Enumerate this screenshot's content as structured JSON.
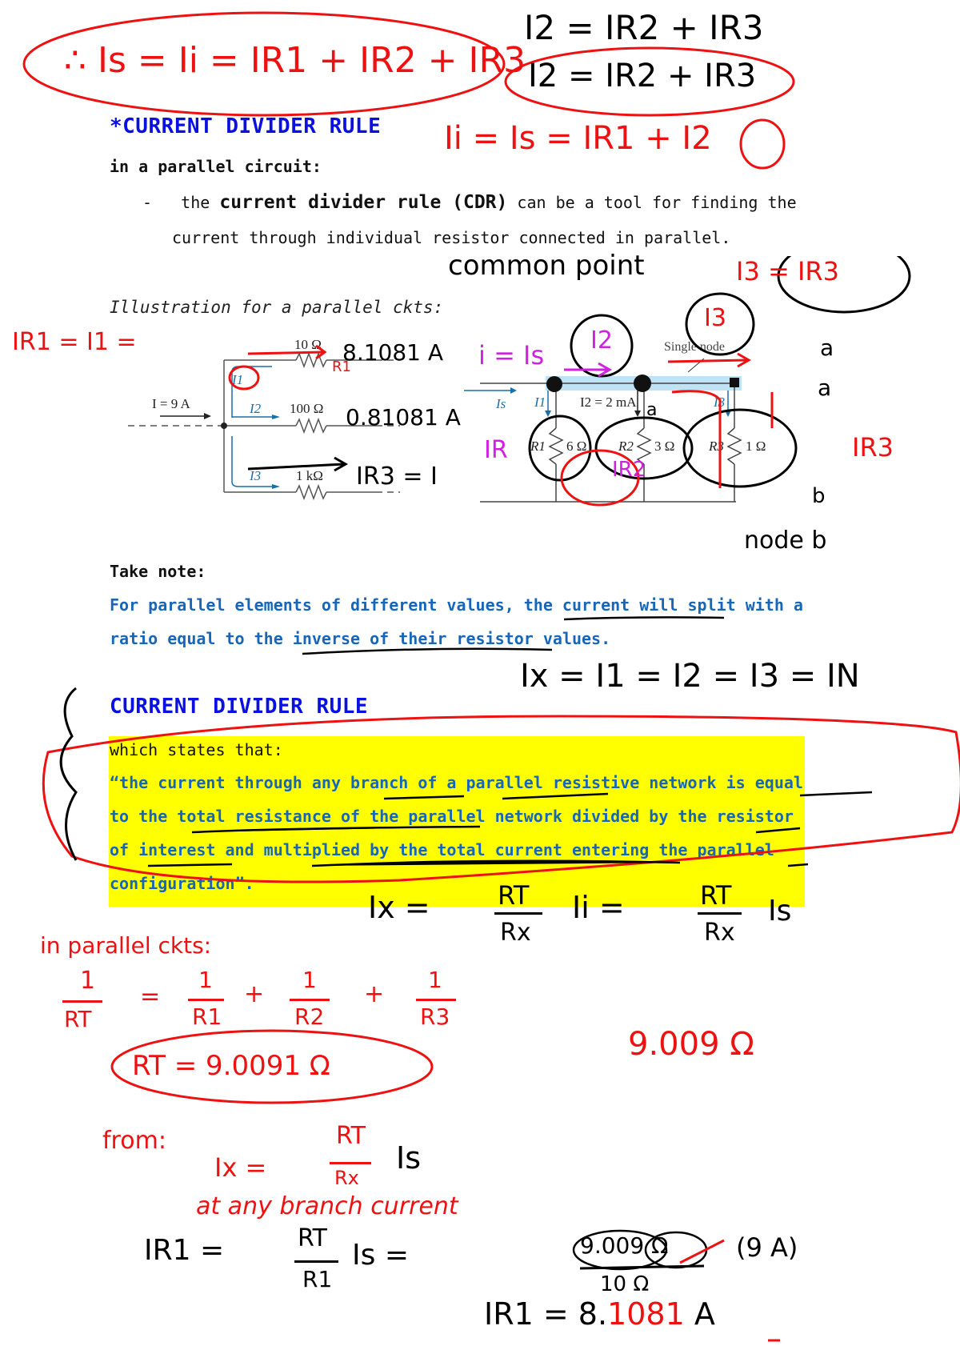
{
  "heading_top": "*CURRENT DIVIDER RULE",
  "intro": "in a parallel circuit:",
  "bullet": {
    "dash": "-",
    "pre": "the ",
    "bold": "current divider rule (CDR)",
    "post_line1": " can be a tool for finding the",
    "line2": "current through individual resistor connected in parallel."
  },
  "illustration_label": "Illustration for a parallel ckts:",
  "left_circuit": {
    "source_label": "I = 9 A",
    "branches": [
      {
        "current": "I1",
        "resistance": "10 Ω"
      },
      {
        "current": "I2",
        "resistance": "100 Ω"
      },
      {
        "current": "I3",
        "resistance": "1 kΩ"
      }
    ]
  },
  "right_circuit": {
    "node_label": "Single node",
    "source_current": "Is",
    "branch_currents": [
      "I1",
      "I2 = 2 mA",
      "I3"
    ],
    "resistors": [
      {
        "name": "R1",
        "value": "6 Ω"
      },
      {
        "name": "R2",
        "value": "3 Ω"
      },
      {
        "name": "R3",
        "value": "1 Ω"
      }
    ]
  },
  "take_note": {
    "label": "Take note:",
    "line1": "For parallel elements of different values, the current will split with a",
    "line2": "ratio equal to the inverse of their resistor values."
  },
  "heading_cdr": "CURRENT DIVIDER RULE",
  "definition": {
    "intro": "which states that:",
    "lines": [
      "“the current through any branch of a parallel resistive network is equal",
      "to the total resistance of the parallel network divided by the resistor",
      "of interest and multiplied by the total current entering the parallel",
      "configuration”."
    ]
  },
  "annotations": {
    "top_eq_main": "∴ Is = Ii = IR1 + IR2 + IR3",
    "top_eq_i2a": "I2 = IR2 + IR3",
    "top_eq_i2b": "I2 = IR2 + IR3",
    "top_eq_ii": "Ii = Is = IR1 + I2",
    "common_point": "common point",
    "ir1_eq": "IR1 = I1 =",
    "val_10ohm": "8.1081 A",
    "r1_tag": "R1",
    "val_100ohm": "0.81081 A",
    "ir3_eq": "IR3 = I",
    "i_is": "i = Is",
    "i2_circle": "I2",
    "i3_circle": "I3",
    "i3_eq_ir3": "I3 = IR3",
    "node_a": "a",
    "node_a2": "a",
    "node_a3": "a",
    "ir_r1": "IR",
    "ir_r2": "IR2",
    "ir_r3": "IR3",
    "node_b": "b",
    "node_b_label": "node b",
    "ix_equal": "Ix = I1 = I2 = I3 = IN",
    "cdr_formula_lhs": "Ix =",
    "cdr_formula_mid_num": "RT",
    "cdr_formula_mid_den": "Rx",
    "cdr_formula_mid_i": "Ii =",
    "cdr_formula_rhs_num": "RT",
    "cdr_formula_rhs_den": "Rx",
    "cdr_formula_rhs_i": "Is",
    "parallel_ckts": "in parallel ckts:",
    "rt_recip_lhs_num": "1",
    "rt_recip_lhs_den": "RT",
    "rt_recip_terms": [
      {
        "num": "1",
        "den": "R1"
      },
      {
        "num": "1",
        "den": "R2"
      },
      {
        "num": "1",
        "den": "R3"
      }
    ],
    "rt_value": "RT = 9.0091 Ω",
    "rt_value_alt": "9.009 Ω",
    "from_label": "from:",
    "from_formula_lhs": "Ix =",
    "from_formula_num": "RT",
    "from_formula_den": "Rx",
    "from_formula_i": "Is",
    "any_branch": "at any branch current",
    "ir1_calc_lhs": "IR1 =",
    "ir1_calc_num": "RT",
    "ir1_calc_den": "R1",
    "ir1_calc_i": "Is =",
    "ir1_calc_value_num": "9.009 Ω",
    "ir1_calc_value_den": "10 Ω",
    "ir1_calc_current": "(9 A)",
    "ir1_result_prefix": "IR1 = 8.",
    "ir1_result_red": "1081",
    "ir1_result_unit": "A"
  },
  "colors": {
    "heading_blue": "#0a10e0",
    "note_blue": "#1866b8",
    "highlight_yellow": "#ffff00",
    "ink_red": "#ee1111",
    "ink_black": "#000000",
    "ink_magenta": "#d020e0",
    "diagram_blue": "#1b6fa8",
    "node_band": "#bfe3f5"
  }
}
